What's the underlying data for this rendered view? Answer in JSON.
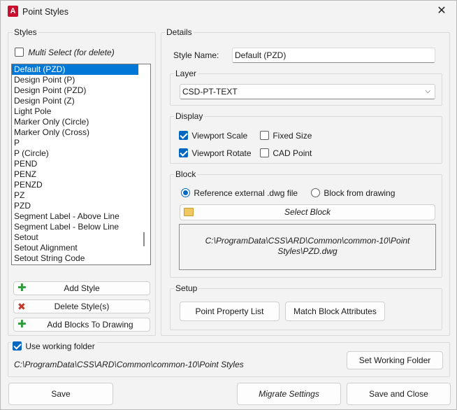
{
  "window": {
    "title": "Point Styles",
    "app_icon_letter": "A"
  },
  "styles": {
    "group_label": "Styles",
    "multi_select_label": "Multi Select (for delete)",
    "multi_select_checked": false,
    "items": [
      "Default (PZD)",
      "Design Point (P)",
      "Design Point (PZD)",
      "Design Point (Z)",
      "Light Pole",
      "Marker Only (Circle)",
      "Marker Only (Cross)",
      "P",
      "P (Circle)",
      "PEND",
      "PENZ",
      "PENZD",
      "PZ",
      "PZD",
      "Segment Label - Above Line",
      "Segment Label - Below Line",
      "Setout",
      "Setout Alignment",
      "Setout String Code"
    ],
    "selected_index": 0,
    "add_style": "Add Style",
    "delete_style": "Delete Style(s)",
    "add_blocks": "Add Blocks To Drawing"
  },
  "details": {
    "group_label": "Details",
    "style_name_label": "Style Name:",
    "style_name_value": "Default (PZD)",
    "layer": {
      "label": "Layer",
      "value": "CSD-PT-TEXT"
    },
    "display": {
      "label": "Display",
      "viewport_scale": "Viewport Scale",
      "fixed_size": "Fixed Size",
      "viewport_rotate": "Viewport Rotate",
      "cad_point": "CAD Point"
    },
    "block": {
      "label": "Block",
      "ref_external": "Reference external .dwg file",
      "from_drawing": "Block from drawing",
      "select_block": "Select Block",
      "path_line1": "C:\\ProgramData\\CSS\\ARD\\Common\\common-10\\Point",
      "path_line2": "Styles\\PZD.dwg"
    },
    "setup": {
      "label": "Setup",
      "point_property_list": "Point Property List",
      "match_block_attributes": "Match Block Attributes"
    }
  },
  "working_folder": {
    "label": "Use working folder",
    "checked": true,
    "path": "C:\\ProgramData\\CSS\\ARD\\Common\\common-10\\Point Styles",
    "set_button": "Set Working Folder"
  },
  "footer": {
    "save": "Save",
    "migrate": "Migrate Settings",
    "save_close": "Save and Close"
  },
  "colors": {
    "accent": "#0067c0",
    "selection": "#0078d7",
    "app_icon": "#c8102e"
  }
}
